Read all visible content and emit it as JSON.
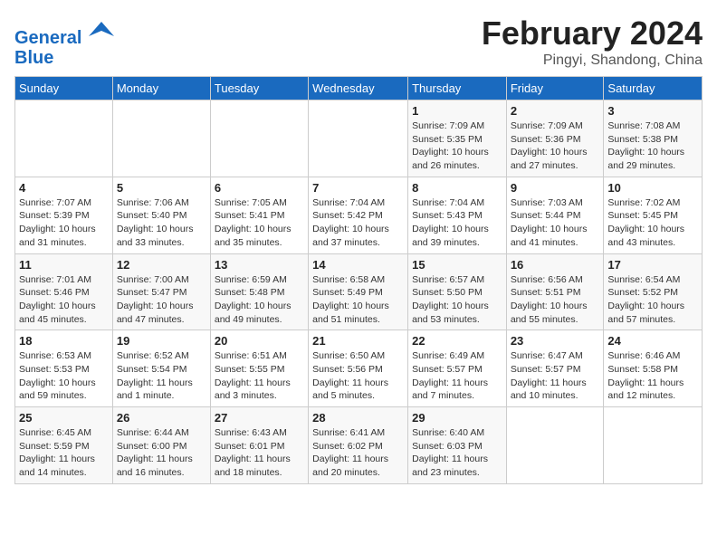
{
  "logo": {
    "line1": "General",
    "line2": "Blue"
  },
  "title": "February 2024",
  "subtitle": "Pingyi, Shandong, China",
  "days_of_week": [
    "Sunday",
    "Monday",
    "Tuesday",
    "Wednesday",
    "Thursday",
    "Friday",
    "Saturday"
  ],
  "weeks": [
    [
      {
        "num": "",
        "info": ""
      },
      {
        "num": "",
        "info": ""
      },
      {
        "num": "",
        "info": ""
      },
      {
        "num": "",
        "info": ""
      },
      {
        "num": "1",
        "info": "Sunrise: 7:09 AM\nSunset: 5:35 PM\nDaylight: 10 hours\nand 26 minutes."
      },
      {
        "num": "2",
        "info": "Sunrise: 7:09 AM\nSunset: 5:36 PM\nDaylight: 10 hours\nand 27 minutes."
      },
      {
        "num": "3",
        "info": "Sunrise: 7:08 AM\nSunset: 5:38 PM\nDaylight: 10 hours\nand 29 minutes."
      }
    ],
    [
      {
        "num": "4",
        "info": "Sunrise: 7:07 AM\nSunset: 5:39 PM\nDaylight: 10 hours\nand 31 minutes."
      },
      {
        "num": "5",
        "info": "Sunrise: 7:06 AM\nSunset: 5:40 PM\nDaylight: 10 hours\nand 33 minutes."
      },
      {
        "num": "6",
        "info": "Sunrise: 7:05 AM\nSunset: 5:41 PM\nDaylight: 10 hours\nand 35 minutes."
      },
      {
        "num": "7",
        "info": "Sunrise: 7:04 AM\nSunset: 5:42 PM\nDaylight: 10 hours\nand 37 minutes."
      },
      {
        "num": "8",
        "info": "Sunrise: 7:04 AM\nSunset: 5:43 PM\nDaylight: 10 hours\nand 39 minutes."
      },
      {
        "num": "9",
        "info": "Sunrise: 7:03 AM\nSunset: 5:44 PM\nDaylight: 10 hours\nand 41 minutes."
      },
      {
        "num": "10",
        "info": "Sunrise: 7:02 AM\nSunset: 5:45 PM\nDaylight: 10 hours\nand 43 minutes."
      }
    ],
    [
      {
        "num": "11",
        "info": "Sunrise: 7:01 AM\nSunset: 5:46 PM\nDaylight: 10 hours\nand 45 minutes."
      },
      {
        "num": "12",
        "info": "Sunrise: 7:00 AM\nSunset: 5:47 PM\nDaylight: 10 hours\nand 47 minutes."
      },
      {
        "num": "13",
        "info": "Sunrise: 6:59 AM\nSunset: 5:48 PM\nDaylight: 10 hours\nand 49 minutes."
      },
      {
        "num": "14",
        "info": "Sunrise: 6:58 AM\nSunset: 5:49 PM\nDaylight: 10 hours\nand 51 minutes."
      },
      {
        "num": "15",
        "info": "Sunrise: 6:57 AM\nSunset: 5:50 PM\nDaylight: 10 hours\nand 53 minutes."
      },
      {
        "num": "16",
        "info": "Sunrise: 6:56 AM\nSunset: 5:51 PM\nDaylight: 10 hours\nand 55 minutes."
      },
      {
        "num": "17",
        "info": "Sunrise: 6:54 AM\nSunset: 5:52 PM\nDaylight: 10 hours\nand 57 minutes."
      }
    ],
    [
      {
        "num": "18",
        "info": "Sunrise: 6:53 AM\nSunset: 5:53 PM\nDaylight: 10 hours\nand 59 minutes."
      },
      {
        "num": "19",
        "info": "Sunrise: 6:52 AM\nSunset: 5:54 PM\nDaylight: 11 hours\nand 1 minute."
      },
      {
        "num": "20",
        "info": "Sunrise: 6:51 AM\nSunset: 5:55 PM\nDaylight: 11 hours\nand 3 minutes."
      },
      {
        "num": "21",
        "info": "Sunrise: 6:50 AM\nSunset: 5:56 PM\nDaylight: 11 hours\nand 5 minutes."
      },
      {
        "num": "22",
        "info": "Sunrise: 6:49 AM\nSunset: 5:57 PM\nDaylight: 11 hours\nand 7 minutes."
      },
      {
        "num": "23",
        "info": "Sunrise: 6:47 AM\nSunset: 5:57 PM\nDaylight: 11 hours\nand 10 minutes."
      },
      {
        "num": "24",
        "info": "Sunrise: 6:46 AM\nSunset: 5:58 PM\nDaylight: 11 hours\nand 12 minutes."
      }
    ],
    [
      {
        "num": "25",
        "info": "Sunrise: 6:45 AM\nSunset: 5:59 PM\nDaylight: 11 hours\nand 14 minutes."
      },
      {
        "num": "26",
        "info": "Sunrise: 6:44 AM\nSunset: 6:00 PM\nDaylight: 11 hours\nand 16 minutes."
      },
      {
        "num": "27",
        "info": "Sunrise: 6:43 AM\nSunset: 6:01 PM\nDaylight: 11 hours\nand 18 minutes."
      },
      {
        "num": "28",
        "info": "Sunrise: 6:41 AM\nSunset: 6:02 PM\nDaylight: 11 hours\nand 20 minutes."
      },
      {
        "num": "29",
        "info": "Sunrise: 6:40 AM\nSunset: 6:03 PM\nDaylight: 11 hours\nand 23 minutes."
      },
      {
        "num": "",
        "info": ""
      },
      {
        "num": "",
        "info": ""
      }
    ]
  ]
}
